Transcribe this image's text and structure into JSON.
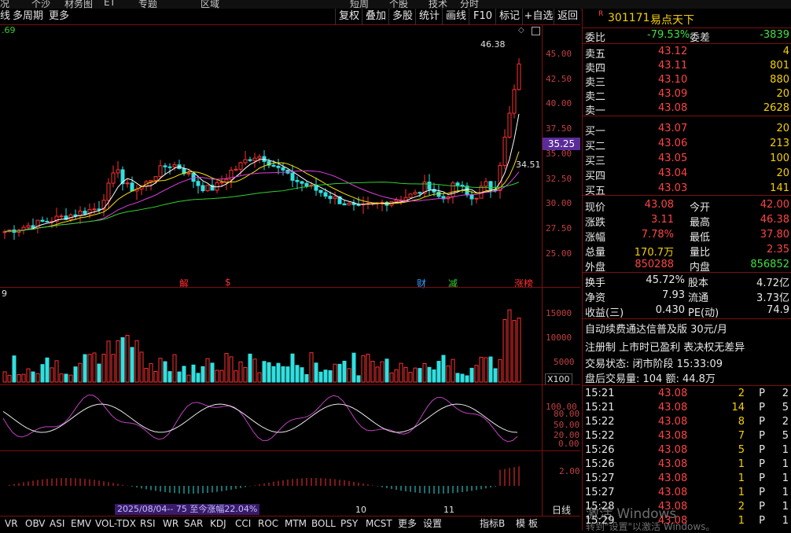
{
  "topbar": {
    "items": [
      "况",
      "个沙",
      "材务图",
      "ET",
      "专题",
      "区域",
      "短周",
      "个股",
      "技术",
      "分时"
    ]
  },
  "toolbar": {
    "left": [
      "线",
      "多周期",
      "更多"
    ],
    "ma_value": ".69",
    "buttons": [
      "复权",
      "叠加",
      "多股",
      "统计",
      "画线",
      "F10",
      "标记",
      "+自选",
      "返回"
    ]
  },
  "chart": {
    "price_labels": [
      "45.00",
      "42.50",
      "40.00",
      "37.50",
      "35.00",
      "32.50",
      "30.00",
      "27.50",
      "25.00"
    ],
    "high_annot": "46.38",
    "low_annot": "34.51",
    "current_price_tag": "35.25",
    "event_labels": [
      {
        "text": "解",
        "color": "#ff3030"
      },
      {
        "text": "$",
        "color": "#ff3030"
      },
      {
        "text": "财",
        "color": "#30a0ff"
      },
      {
        "text": "减",
        "color": "#30d030"
      },
      {
        "text": "涨榜",
        "color": "#ff3030"
      }
    ],
    "vol_header": "9",
    "vol_labels": [
      "15000",
      "10000",
      "5000"
    ],
    "vol_unit": "X100",
    "osc_labels": [
      "100.00",
      "80.00",
      "50.00",
      "20.00",
      "0.00"
    ],
    "macd_labels": [
      "2.00"
    ],
    "range_note": "2025/08/04-- 75 至今涨幅22.04%",
    "month_labels": [
      "10",
      "11"
    ],
    "timeframe": "日线"
  },
  "bottom_tabs": [
    "VR",
    "OBV",
    "ASI",
    "EMV",
    "VOL-TDX",
    "RSI",
    "WR",
    "SAR",
    "KDJ",
    "CCI",
    "ROC",
    "MTM",
    "BOLL",
    "PSY",
    "MCST",
    "更多",
    "设置",
    "指标B",
    "模",
    "板"
  ],
  "stock": {
    "market": "R",
    "code": "301171",
    "name": "易点天下"
  },
  "orderbook": {
    "weibi_label": "委比",
    "weibi": "-79.53%",
    "weicha_label": "委差",
    "weicha": "-3839",
    "asks": [
      {
        "label": "卖五",
        "price": "43.12",
        "vol": "4"
      },
      {
        "label": "卖四",
        "price": "43.11",
        "vol": "801"
      },
      {
        "label": "卖三",
        "price": "43.10",
        "vol": "880"
      },
      {
        "label": "卖二",
        "price": "43.09",
        "vol": "20"
      },
      {
        "label": "卖一",
        "price": "43.08",
        "vol": "2628"
      }
    ],
    "bids": [
      {
        "label": "买一",
        "price": "43.07",
        "vol": "20"
      },
      {
        "label": "买二",
        "price": "43.06",
        "vol": "213"
      },
      {
        "label": "买三",
        "price": "43.05",
        "vol": "100"
      },
      {
        "label": "买四",
        "price": "43.04",
        "vol": "20"
      },
      {
        "label": "买五",
        "price": "43.03",
        "vol": "141"
      }
    ]
  },
  "quote": [
    {
      "l1": "现价",
      "v1": "43.08",
      "c1": "red",
      "l2": "今开",
      "v2": "42.00",
      "c2": "red"
    },
    {
      "l1": "涨跌",
      "v1": "3.11",
      "c1": "red",
      "l2": "最高",
      "v2": "46.38",
      "c2": "red"
    },
    {
      "l1": "涨幅",
      "v1": "7.78%",
      "c1": "red",
      "l2": "最低",
      "v2": "37.80",
      "c2": "red"
    },
    {
      "l1": "总量",
      "v1": "170.7万",
      "c1": "yel",
      "l2": "量比",
      "v2": "2.35",
      "c2": "red"
    },
    {
      "l1": "外盘",
      "v1": "850288",
      "c1": "red",
      "l2": "内盘",
      "v2": "856852",
      "c2": "grn"
    }
  ],
  "fund": [
    {
      "l1": "换手",
      "v1": "45.72%",
      "l2": "股本",
      "v2": "4.72亿"
    },
    {
      "l1": "净资",
      "v1": "7.93",
      "l2": "流通",
      "v2": "3.73亿"
    },
    {
      "l1": "收益(三)",
      "v1": "0.430",
      "l2": "PE(动)",
      "v2": "74.9"
    }
  ],
  "info": {
    "promo": "自动续费通达信普及版  30元/月",
    "note": "注册制 上市时已盈利 表决权无差异",
    "status": "交易状态: 闭市阶段 15:33:09",
    "after": "盘后交易量: 104  额: 44.8万"
  },
  "ticks": [
    {
      "time": "15:21",
      "price": "43.08",
      "vol": "2",
      "flag": "P",
      "n": "2"
    },
    {
      "time": "15:21",
      "price": "43.08",
      "vol": "14",
      "flag": "P",
      "n": "5"
    },
    {
      "time": "15:22",
      "price": "43.08",
      "vol": "8",
      "flag": "P",
      "n": "2"
    },
    {
      "time": "15:22",
      "price": "43.08",
      "vol": "7",
      "flag": "P",
      "n": "5"
    },
    {
      "time": "15:26",
      "price": "43.08",
      "vol": "5",
      "flag": "P",
      "n": "1"
    },
    {
      "time": "15:26",
      "price": "43.08",
      "vol": "1",
      "flag": "P",
      "n": "1"
    },
    {
      "time": "15:27",
      "price": "43.08",
      "vol": "1",
      "flag": "P",
      "n": "1"
    },
    {
      "time": "15:27",
      "price": "43.08",
      "vol": "1",
      "flag": "P",
      "n": "1"
    },
    {
      "time": "15:28",
      "price": "43.08",
      "vol": "2",
      "flag": "P",
      "n": "1"
    },
    {
      "time": "15:29",
      "price": "43.08",
      "vol": "1",
      "flag": "P",
      "n": "1"
    }
  ],
  "watermark": {
    "line1": "激活 Windows",
    "line2": "转到\"设置\"以激活 Windows。"
  },
  "colors": {
    "up": "#ff3030",
    "down": "#30e0e0",
    "ma5": "#ffffff",
    "ma10": "#f5e000",
    "ma20": "#e040e0",
    "ma60": "#30d030",
    "axis": "#7a1010"
  }
}
